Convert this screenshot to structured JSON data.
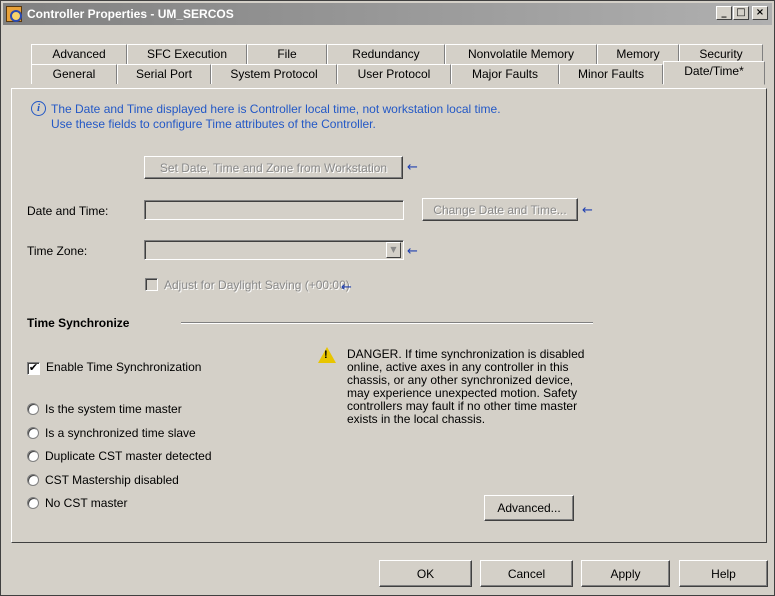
{
  "window": {
    "title": "Controller Properties - UM_SERCOS",
    "minimize_glyph": "_",
    "maximize_glyph": "□",
    "close_glyph": "×"
  },
  "tabs_back": [
    {
      "label": "Advanced"
    },
    {
      "label": "SFC Execution"
    },
    {
      "label": "File"
    },
    {
      "label": "Redundancy"
    },
    {
      "label": "Nonvolatile Memory"
    },
    {
      "label": "Memory"
    },
    {
      "label": "Security"
    }
  ],
  "tabs_front": [
    {
      "label": "General"
    },
    {
      "label": "Serial Port"
    },
    {
      "label": "System Protocol"
    },
    {
      "label": "User Protocol"
    },
    {
      "label": "Major Faults"
    },
    {
      "label": "Minor Faults"
    },
    {
      "label": "Date/Time*"
    }
  ],
  "info": {
    "line1": "The Date and Time displayed here is Controller local time, not workstation local time.",
    "line2": "Use these fields to configure Time attributes of the Controller."
  },
  "set_from_workstation_label": "Set Date, Time and Zone from Workstation",
  "date_time": {
    "label": "Date and Time:",
    "value": "",
    "change_button_label": "Change Date and Time..."
  },
  "time_zone": {
    "label": "Time Zone:",
    "value": ""
  },
  "daylight_saving_label": "Adjust for Daylight Saving (+00:00)",
  "time_sync": {
    "heading": "Time Synchronize",
    "enable_label": "Enable Time Synchronization",
    "enable_checked": true,
    "enable_check_glyph": "✔",
    "status_options": [
      {
        "label": "Is the system time master"
      },
      {
        "label": "Is a synchronized time slave"
      },
      {
        "label": "Duplicate CST master detected"
      },
      {
        "label": "CST Mastership disabled"
      },
      {
        "label": "No CST master"
      }
    ],
    "danger_text": "DANGER. If time synchronization is disabled online, active axes in any controller in this chassis, or any other synchronized device, may experience unexpected motion.  Safety controllers may fault if no other time master exists in the local chassis.",
    "advanced_button_label": "Advanced..."
  },
  "footer": {
    "ok_label": "OK",
    "cancel_label": "Cancel",
    "apply_label": "Apply",
    "help_label": "Help"
  },
  "icons": {
    "arrow": "←",
    "info": "i",
    "warning": "!",
    "dropdown": "▼"
  }
}
